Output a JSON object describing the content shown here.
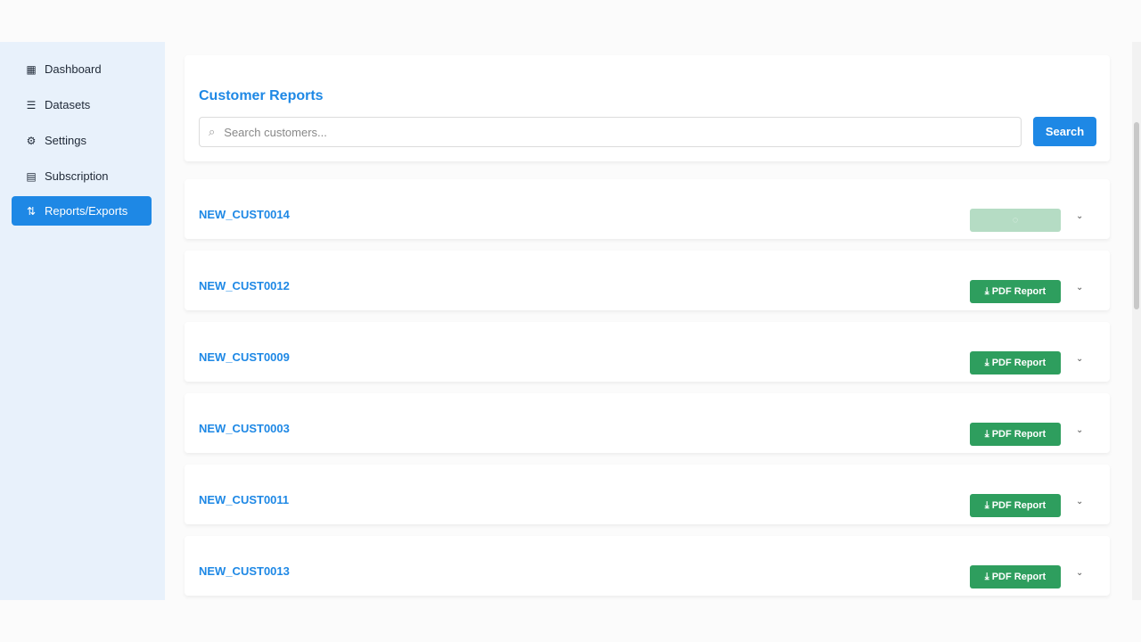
{
  "sidebar": {
    "items": [
      {
        "label": "Dashboard",
        "icon": "dashboard-icon"
      },
      {
        "label": "Datasets",
        "icon": "list-icon"
      },
      {
        "label": "Settings",
        "icon": "gear-icon"
      },
      {
        "label": "Subscription",
        "icon": "card-icon"
      },
      {
        "label": "Reports/Exports",
        "icon": "sort-arrows-icon",
        "active": true
      }
    ]
  },
  "main": {
    "title": "Customer Reports",
    "search_placeholder": "Search customers...",
    "search_label": "Search",
    "pdf_label": "PDF Report",
    "customers": [
      "NEW_CUST0014",
      "NEW_CUST0012",
      "NEW_CUST0009",
      "NEW_CUST0003",
      "NEW_CUST0011",
      "NEW_CUST0013"
    ]
  },
  "colors": {
    "primary": "#1e88e5",
    "success": "#2e9e5e"
  }
}
